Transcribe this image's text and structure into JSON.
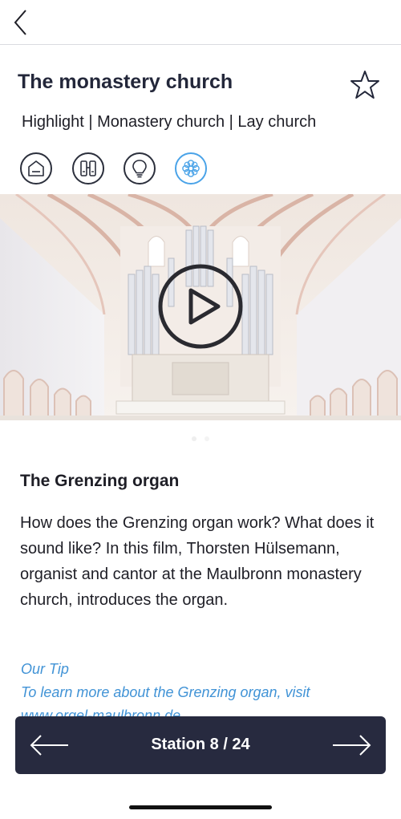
{
  "header": {
    "back_icon": "chevron-left-icon"
  },
  "station": {
    "title": "The monastery church",
    "favorite_icon": "star-outline-icon",
    "categories": "Highlight | Monastery church | Lay church",
    "category_icons": [
      {
        "name": "house-icon",
        "active": false
      },
      {
        "name": "binoculars-icon",
        "active": false
      },
      {
        "name": "lightbulb-icon",
        "active": false
      },
      {
        "name": "flower-icon",
        "active": true
      }
    ]
  },
  "media": {
    "play_icon": "play-icon",
    "slide_count": 2,
    "active_slide": 0
  },
  "content": {
    "heading": "The Grenzing organ",
    "body": "How does the Grenzing organ work? What does it sound like? In this film, Thorsten Hülsemann, organist and cantor at the Maulbronn monastery church, introduces the organ.",
    "tip_title": "Our Tip",
    "tip_text": "To learn more about the Grenzing organ, visit",
    "tip_link": "www.orgel-maulbronn.de"
  },
  "navigation": {
    "label": "Station 8 / 24",
    "prev_icon": "arrow-left-icon",
    "next_icon": "arrow-right-icon"
  },
  "colors": {
    "accent": "#4aa3e8",
    "dark_bar": "#272a3f",
    "link": "#4193d6"
  }
}
